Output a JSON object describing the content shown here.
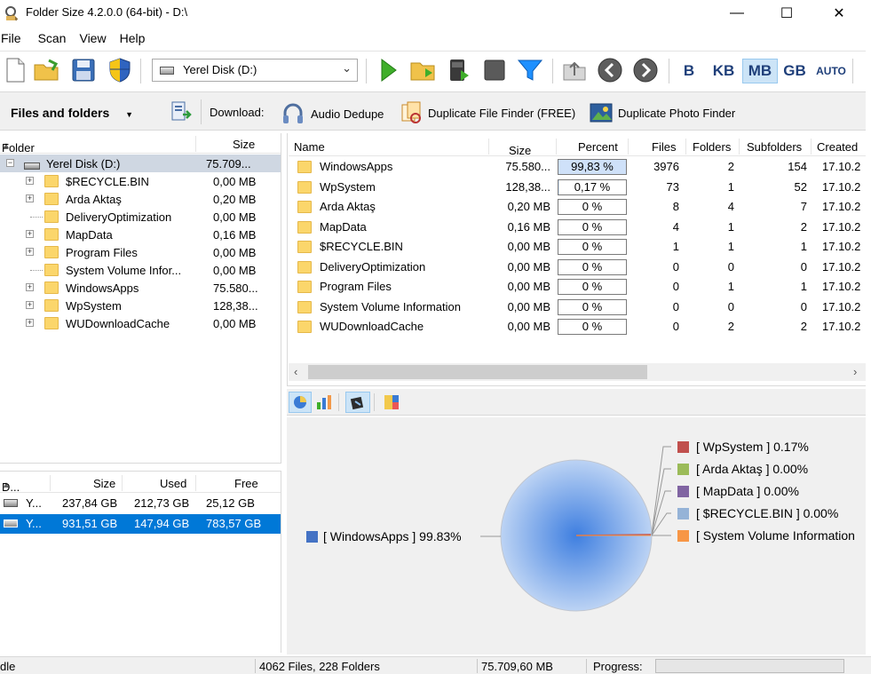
{
  "window": {
    "title": "Folder Size 4.2.0.0 (64-bit) - D:\\",
    "minimize": "—",
    "maximize": "☐",
    "close": "✕"
  },
  "menu": [
    "File",
    "Scan",
    "View",
    "Help"
  ],
  "toolbar": {
    "drive_select": "Yerel Disk (D:)",
    "units": [
      "B",
      "KB",
      "MB",
      "GB",
      "AUTO"
    ],
    "active_unit": "MB"
  },
  "secondbar": {
    "files_and_folders": "Files and folders",
    "download_label": "Download:",
    "links": [
      "Audio Dedupe",
      "Duplicate File Finder (FREE)",
      "Duplicate Photo Finder"
    ]
  },
  "tree": {
    "headers": {
      "folder": "Folder",
      "size": "Size"
    },
    "root": {
      "name": "Yerel Disk (D:)",
      "size": "75.709..."
    },
    "items": [
      {
        "name": "$RECYCLE.BIN",
        "size": "0,00 MB",
        "expandable": true
      },
      {
        "name": "Arda Aktaş",
        "size": "0,20 MB",
        "expandable": true
      },
      {
        "name": "DeliveryOptimization",
        "size": "0,00 MB",
        "expandable": false
      },
      {
        "name": "MapData",
        "size": "0,16 MB",
        "expandable": true
      },
      {
        "name": "Program Files",
        "size": "0,00 MB",
        "expandable": true
      },
      {
        "name": "System Volume Infor...",
        "size": "0,00 MB",
        "expandable": false
      },
      {
        "name": "WindowsApps",
        "size": "75.580...",
        "expandable": true
      },
      {
        "name": "WpSystem",
        "size": "128,38...",
        "expandable": true
      },
      {
        "name": "WUDownloadCache",
        "size": "0,00 MB",
        "expandable": true
      }
    ]
  },
  "drives": {
    "headers": {
      "drive": "D...",
      "size": "Size",
      "used": "Used",
      "free": "Free"
    },
    "rows": [
      {
        "name": "Y...",
        "size": "237,84 GB",
        "used": "212,73 GB",
        "free": "25,12 GB",
        "selected": false
      },
      {
        "name": "Y...",
        "size": "931,51 GB",
        "used": "147,94 GB",
        "free": "783,57 GB",
        "selected": true
      }
    ]
  },
  "list": {
    "headers": {
      "name": "Name",
      "size": "Size",
      "percent": "Percent",
      "files": "Files",
      "folders": "Folders",
      "subfolders": "Subfolders",
      "created": "Created"
    },
    "rows": [
      {
        "name": "WindowsApps",
        "size": "75.580...",
        "percent": "99,83 %",
        "pct": 0.9983,
        "files": "3976",
        "folders": "2",
        "subfolders": "154",
        "created": "17.10.2"
      },
      {
        "name": "WpSystem",
        "size": "128,38...",
        "percent": "0,17 %",
        "pct": 0.0017,
        "files": "73",
        "folders": "1",
        "subfolders": "52",
        "created": "17.10.2"
      },
      {
        "name": "Arda Aktaş",
        "size": "0,20 MB",
        "percent": "0 %",
        "pct": 0,
        "files": "8",
        "folders": "4",
        "subfolders": "7",
        "created": "17.10.2"
      },
      {
        "name": "MapData",
        "size": "0,16 MB",
        "percent": "0 %",
        "pct": 0,
        "files": "4",
        "folders": "1",
        "subfolders": "2",
        "created": "17.10.2"
      },
      {
        "name": "$RECYCLE.BIN",
        "size": "0,00 MB",
        "percent": "0 %",
        "pct": 0,
        "files": "1",
        "folders": "1",
        "subfolders": "1",
        "created": "17.10.2"
      },
      {
        "name": "DeliveryOptimization",
        "size": "0,00 MB",
        "percent": "0 %",
        "pct": 0,
        "files": "0",
        "folders": "0",
        "subfolders": "0",
        "created": "17.10.2"
      },
      {
        "name": "Program Files",
        "size": "0,00 MB",
        "percent": "0 %",
        "pct": 0,
        "files": "0",
        "folders": "1",
        "subfolders": "1",
        "created": "17.10.2"
      },
      {
        "name": "System Volume Information",
        "size": "0,00 MB",
        "percent": "0 %",
        "pct": 0,
        "files": "0",
        "folders": "0",
        "subfolders": "0",
        "created": "17.10.2"
      },
      {
        "name": "WUDownloadCache",
        "size": "0,00 MB",
        "percent": "0 %",
        "pct": 0,
        "files": "0",
        "folders": "2",
        "subfolders": "2",
        "created": "17.10.2"
      }
    ]
  },
  "chart": {
    "main_label": "[ WindowsApps ] 99.83%",
    "main_color": "#4472c4",
    "legend": [
      {
        "label": "[ WpSystem ] 0.17%",
        "color": "#c0504d"
      },
      {
        "label": "[ Arda Aktaş ] 0.00%",
        "color": "#9bbb59"
      },
      {
        "label": "[ MapData ] 0.00%",
        "color": "#8064a2"
      },
      {
        "label": "[ $RECYCLE.BIN ] 0.00%",
        "color": "#95b3d7"
      },
      {
        "label": "[ System Volume Information",
        "color": "#f79646"
      }
    ]
  },
  "status": {
    "state": "dle",
    "counts": "4062 Files, 228 Folders",
    "total": "75.709,60 MB",
    "progress_label": "Progress:"
  }
}
